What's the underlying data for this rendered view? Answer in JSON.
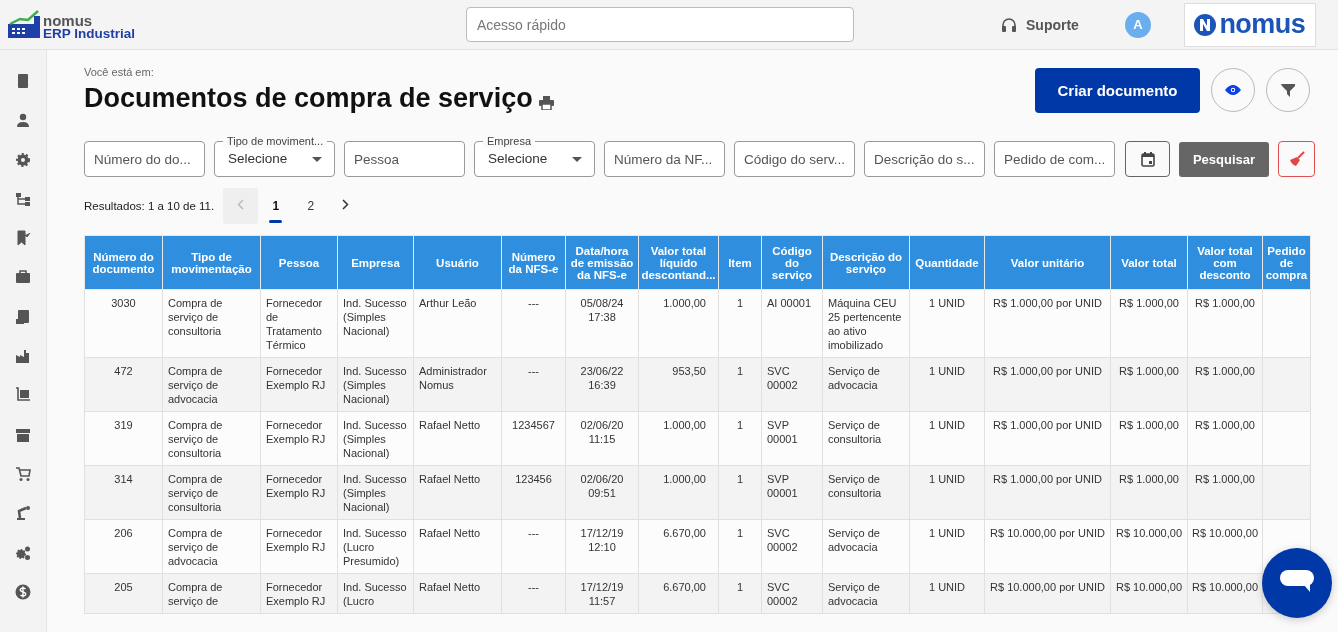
{
  "header": {
    "logo_top": "nomus",
    "logo_bottom": "ERP Industrial",
    "search": {
      "placeholder": "Acesso rápido"
    },
    "support": "Suporte",
    "avatar": "A",
    "brand": "nomus"
  },
  "breadcrumb": "Você está em:",
  "title": "Documentos de compra de serviço",
  "create_button": "Criar documento",
  "filters": [
    {
      "kind": "input",
      "placeholder": "Número do do..."
    },
    {
      "kind": "select",
      "label": "Tipo de moviment...",
      "value": "Selecione"
    },
    {
      "kind": "input",
      "placeholder": "Pessoa"
    },
    {
      "kind": "select",
      "label": "Empresa",
      "value": "Selecione"
    },
    {
      "kind": "input",
      "placeholder": "Número da NF..."
    },
    {
      "kind": "input",
      "placeholder": "Código do serv..."
    },
    {
      "kind": "input",
      "placeholder": "Descrição do s..."
    },
    {
      "kind": "input",
      "placeholder": "Pedido de com..."
    }
  ],
  "search_button": "Pesquisar",
  "results": "Resultados: 1 a 10 de 11.",
  "pagination": {
    "prev_disabled": true,
    "pages": [
      {
        "label": "1",
        "selected": true
      },
      {
        "label": "2",
        "selected": false
      }
    ],
    "next_disabled": false
  },
  "table": {
    "columns": [
      "Número do documento",
      "Tipo de movimentação",
      "Pessoa",
      "Empresa",
      "Usuário",
      "Número da NFS-e",
      "Data/hora de emissão da NFS-e",
      "Valor total líquido descontand...",
      "Item",
      "Código do serviço",
      "Descrição do serviço",
      "Quantidade",
      "Valor unitário",
      "Valor total",
      "Valor total com desconto",
      "Pedido de compra"
    ],
    "rows": [
      [
        "3030",
        "Compra de serviço de consultoria",
        "Fornecedor de Tratamento Térmico",
        "Ind. Sucesso (Simples Nacional)",
        "Arthur Leão",
        "---",
        "05/08/24 17:38",
        "1.000,00",
        "1",
        "AI 00001",
        "Máquina CEU 25 pertencente ao ativo imobilizado",
        "1 UNID",
        "R$ 1.000,00 por UNID",
        "R$ 1.000,00",
        "R$ 1.000,00",
        ""
      ],
      [
        "472",
        "Compra de serviço de advocacia",
        "Fornecedor Exemplo RJ",
        "Ind. Sucesso (Simples Nacional)",
        "Administrador Nomus",
        "---",
        "23/06/22 16:39",
        "953,50",
        "1",
        "SVC 00002",
        "Serviço de advocacia",
        "1 UNID",
        "R$ 1.000,00 por UNID",
        "R$ 1.000,00",
        "R$ 1.000,00",
        ""
      ],
      [
        "319",
        "Compra de serviço de consultoria",
        "Fornecedor Exemplo RJ",
        "Ind. Sucesso (Simples Nacional)",
        "Rafael Netto",
        "1234567",
        "02/06/20 11:15",
        "1.000,00",
        "1",
        "SVP 00001",
        "Serviço de consultoria",
        "1 UNID",
        "R$ 1.000,00 por UNID",
        "R$ 1.000,00",
        "R$ 1.000,00",
        ""
      ],
      [
        "314",
        "Compra de serviço de consultoria",
        "Fornecedor Exemplo RJ",
        "Ind. Sucesso (Simples Nacional)",
        "Rafael Netto",
        "123456",
        "02/06/20 09:51",
        "1.000,00",
        "1",
        "SVP 00001",
        "Serviço de consultoria",
        "1 UNID",
        "R$ 1.000,00 por UNID",
        "R$ 1.000,00",
        "R$ 1.000,00",
        ""
      ],
      [
        "206",
        "Compra de serviço de advocacia",
        "Fornecedor Exemplo RJ",
        "Ind. Sucesso (Lucro Presumido)",
        "Rafael Netto",
        "---",
        "17/12/19 12:10",
        "6.670,00",
        "1",
        "SVC 00002",
        "Serviço de advocacia",
        "1 UNID",
        "R$ 10.000,00 por UNID",
        "R$ 10.000,00",
        "R$ 10.000,00",
        ""
      ],
      [
        "205",
        "Compra de serviço de",
        "Fornecedor Exemplo RJ",
        "Ind. Sucesso (Lucro",
        "Rafael Netto",
        "---",
        "17/12/19 11:57",
        "6.670,00",
        "1",
        "SVC 00002",
        "Serviço de advocacia",
        "1 UNID",
        "R$ 10.000,00 por UNID",
        "R$ 10.000,00",
        "R$ 10.000,00",
        ""
      ]
    ]
  }
}
